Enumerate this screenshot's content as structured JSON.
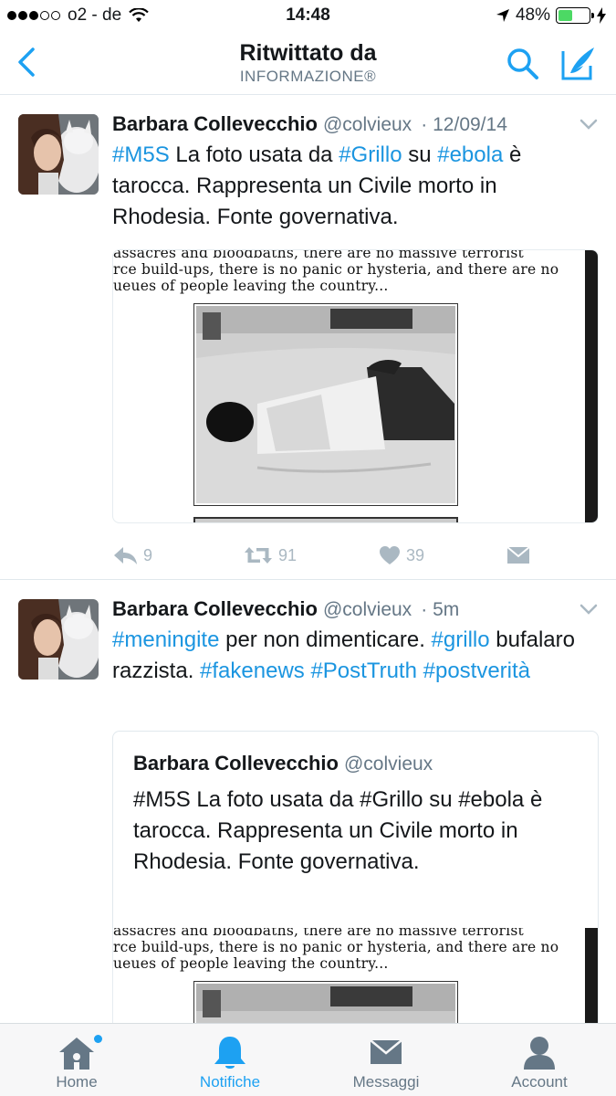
{
  "status_bar": {
    "carrier": "o2 - de",
    "time": "14:48",
    "battery": "48%",
    "signal_bars_on": 3,
    "signal_bars_total": 5,
    "battery_level": 0.48
  },
  "nav": {
    "title": "Ritwittato da",
    "subtitle": "INFORMAZIONE®"
  },
  "tweets": [
    {
      "name": "Barbara Collevecchio",
      "handle": "@colvieux",
      "time": "· 12/09/14",
      "text_parts": [
        {
          "t": "#M5S",
          "tag": true
        },
        {
          "t": " La foto usata da ",
          "tag": false
        },
        {
          "t": "#Grillo",
          "tag": true
        },
        {
          "t": " su ",
          "tag": false
        },
        {
          "t": "#ebola",
          "tag": true
        },
        {
          "t": " è tarocca. Rappresenta un Civile morto in Rhodesia. Fonte governativa.",
          "tag": false
        }
      ],
      "media_text": [
        "assacres and bloodbaths, there are no massive terrorist",
        "rce build-ups, there is no panic or hysteria, and there are no",
        "ueues of people leaving the country..."
      ],
      "reply_count": "9",
      "retweet_count": "91",
      "like_count": "39"
    },
    {
      "name": "Barbara Collevecchio",
      "handle": "@colvieux",
      "time": "· 5m",
      "text_parts": [
        {
          "t": "#meningite",
          "tag": true
        },
        {
          "t": " per non dimenticare. ",
          "tag": false
        },
        {
          "t": "#grillo",
          "tag": true
        },
        {
          "t": " bufalaro razzista. ",
          "tag": false
        },
        {
          "t": "#fakenews",
          "tag": true
        },
        {
          "t": " ",
          "tag": false
        },
        {
          "t": "#PostTruth",
          "tag": true
        },
        {
          "t": " ",
          "tag": false
        },
        {
          "t": "#postverità",
          "tag": true
        }
      ],
      "quote": {
        "name": "Barbara Collevecchio",
        "handle": "@colvieux",
        "text": "#M5S La foto usata da #Grillo su #ebola è tarocca. Rappresenta un Civile morto in Rhodesia. Fonte governativa."
      },
      "media_text": [
        "assacres and bloodbaths, there are no massive terrorist",
        "rce build-ups, there is no panic or hysteria, and there are no",
        "ueues of people leaving the country..."
      ]
    }
  ],
  "tabs": [
    {
      "label": "Home",
      "icon": "home-icon",
      "active": false,
      "badge": true
    },
    {
      "label": "Notifiche",
      "icon": "bell-icon",
      "active": true,
      "badge": false
    },
    {
      "label": "Messaggi",
      "icon": "envelope-icon",
      "active": false,
      "badge": false
    },
    {
      "label": "Account",
      "icon": "person-icon",
      "active": false,
      "badge": false
    }
  ],
  "colors": {
    "accent": "#1da1f2",
    "hashtag": "#1b95e0",
    "muted": "#657786",
    "action_gray": "#aab8c2",
    "battery_green": "#4cd964"
  }
}
